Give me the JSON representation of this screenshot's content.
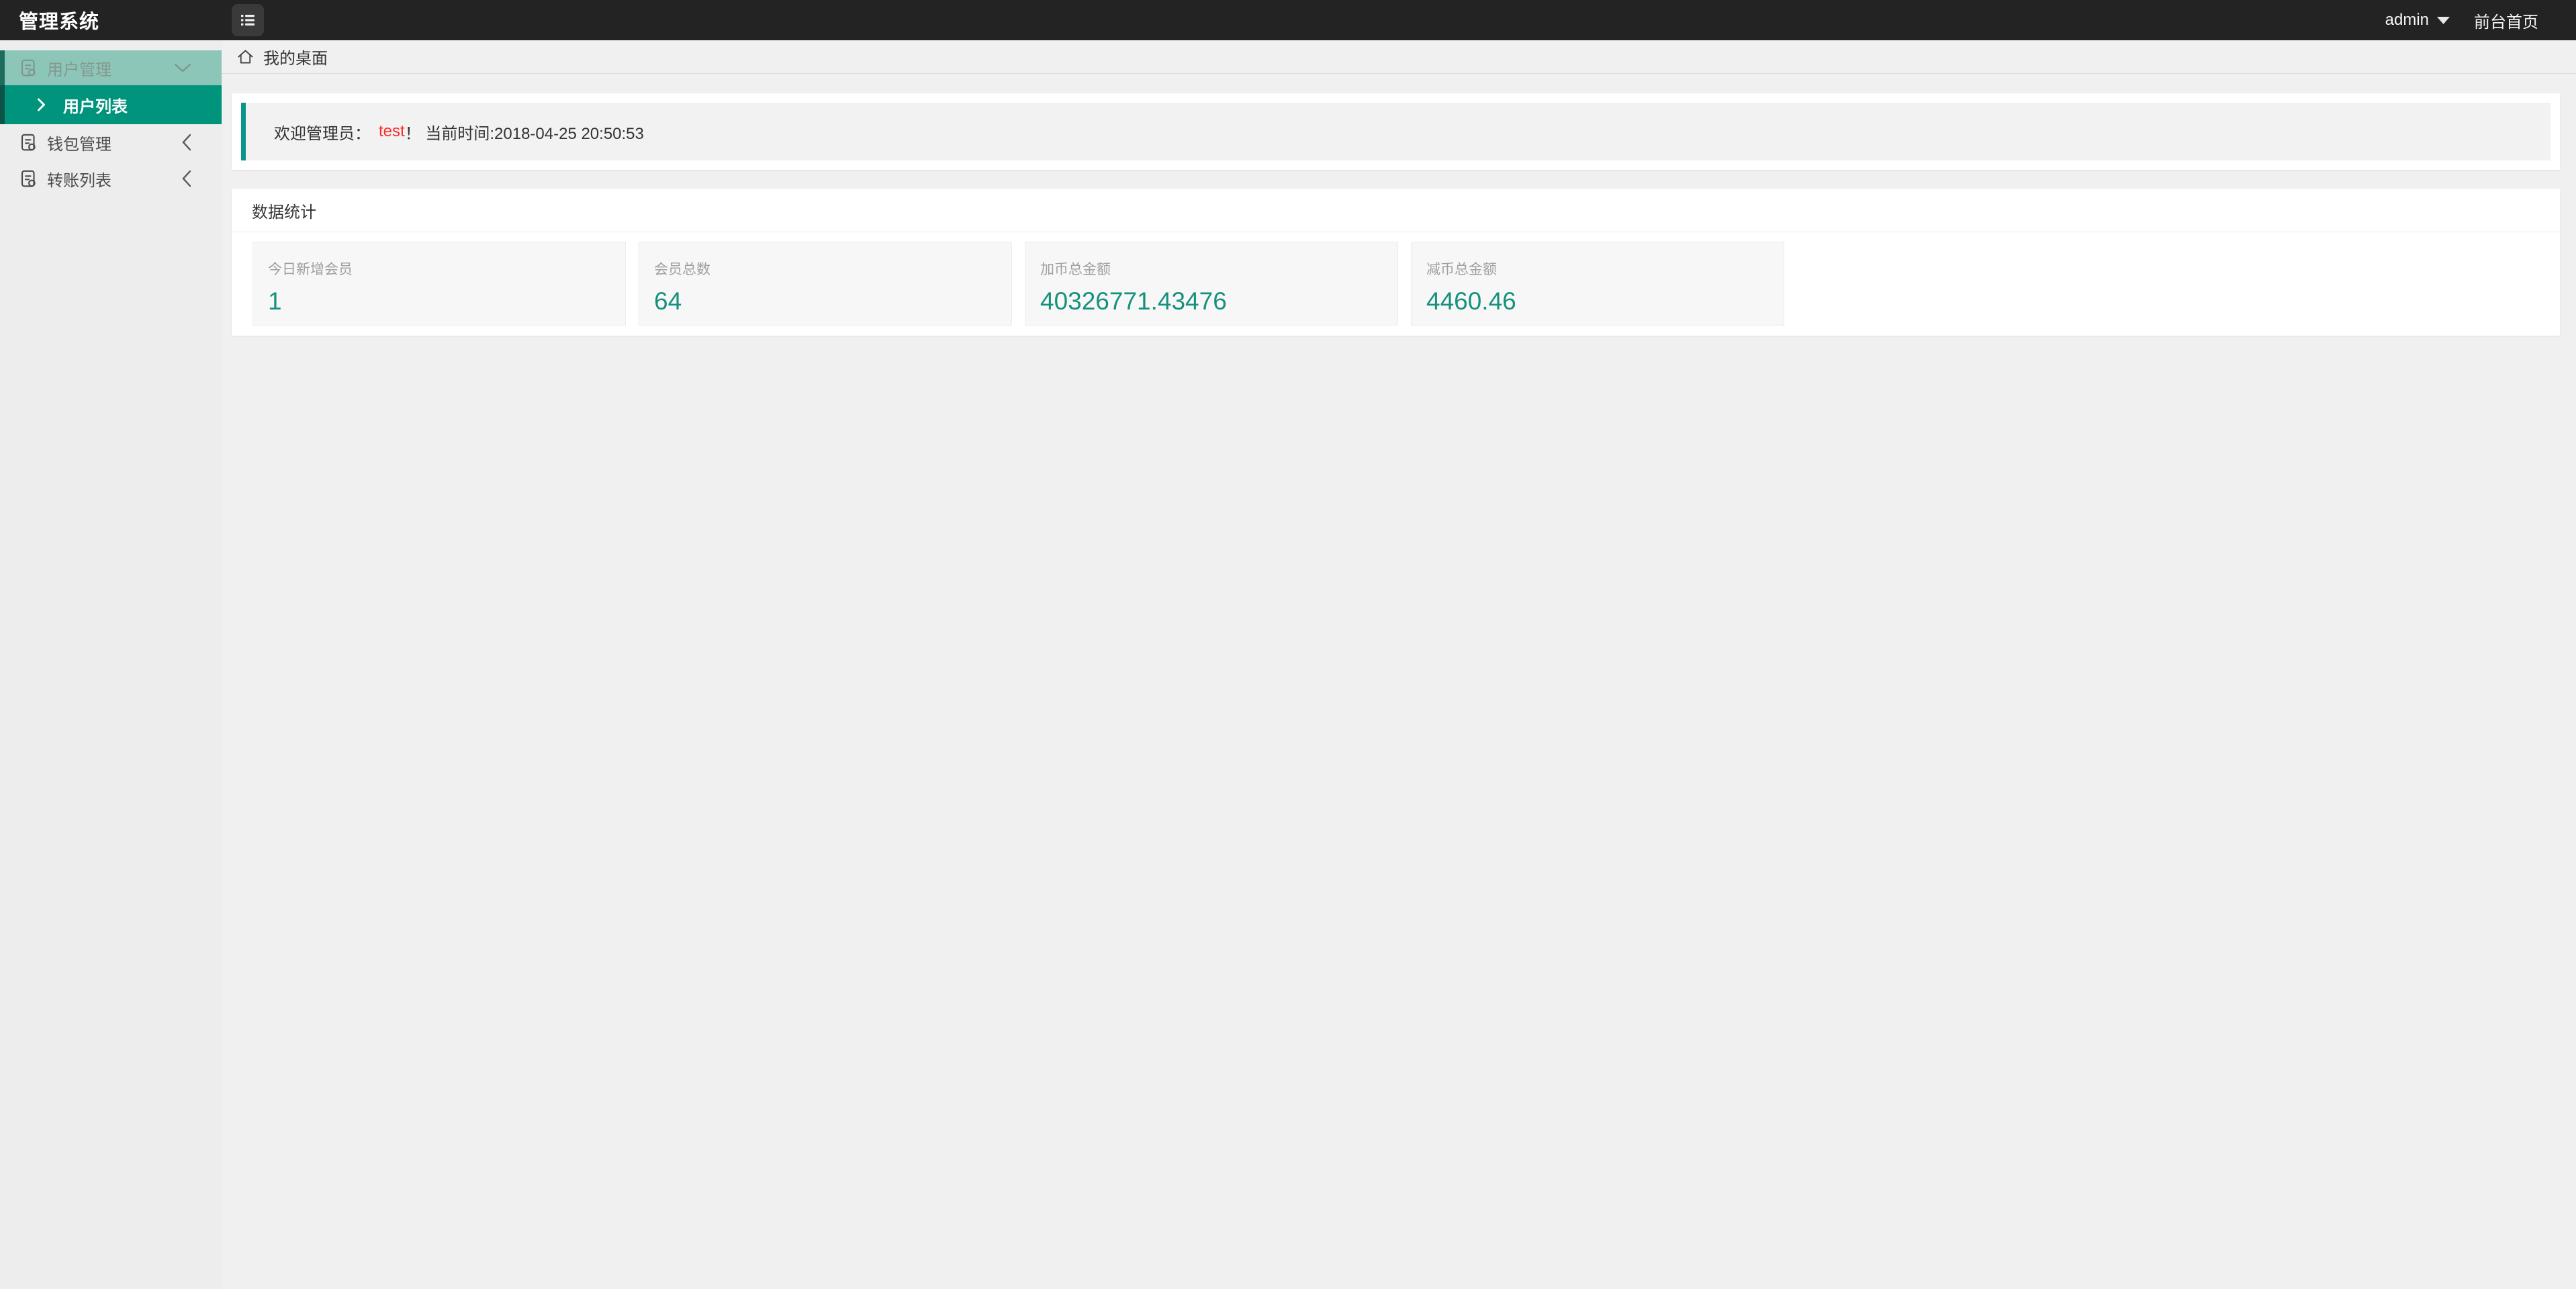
{
  "topbar": {
    "title": "管理系统",
    "user": "admin",
    "frontend_link": "前台首页"
  },
  "sidebar": {
    "groups": [
      {
        "label": "用户管理",
        "state": "open"
      },
      {
        "label": "钱包管理",
        "state": "collapsed"
      },
      {
        "label": "转账列表",
        "state": "collapsed"
      }
    ],
    "active_item": {
      "label": "用户列表"
    }
  },
  "breadcrumb": {
    "label": "我的桌面"
  },
  "alert": {
    "prefix": "欢迎管理员：",
    "user": "test",
    "suffix": "！ 当前时间:2018-04-25 20:50:53"
  },
  "stats_panel": {
    "title": "数据统计",
    "cards": [
      {
        "label": "今日新增会员",
        "value": "1"
      },
      {
        "label": "会员总数",
        "value": "64"
      },
      {
        "label": "加币总金额",
        "value": "40326771.43476"
      },
      {
        "label": "减币总金额",
        "value": "4460.46"
      }
    ]
  },
  "colors": {
    "topbar_bg": "#232323",
    "accent_teal": "#00947d",
    "open_group_teal": "#8cc6b8",
    "alert_border": "#0d9488",
    "stat_value_teal": "#16917e",
    "admin_name_red": "#fe2b2b",
    "sidebar_bg": "#ededed",
    "page_bg": "#f0f0f0"
  }
}
